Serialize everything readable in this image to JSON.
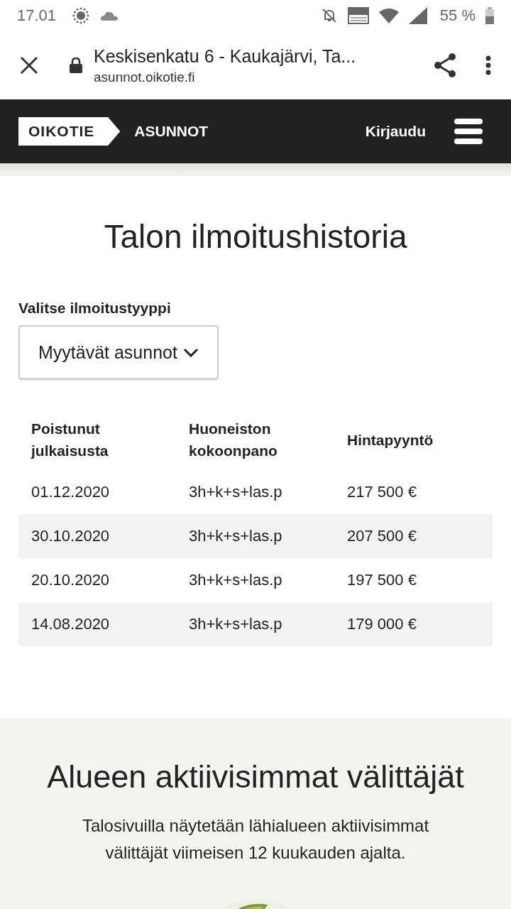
{
  "status_bar": {
    "time": "17.01",
    "battery": "55 %"
  },
  "browser": {
    "title": "Keskisenkatu 6 - Kaukajärvi, Ta...",
    "url": "asunnot.oikotie.fi"
  },
  "nav": {
    "logo": "OIKOTIE",
    "section": "ASUNNOT",
    "login": "Kirjaudu"
  },
  "history": {
    "title": "Talon ilmoitushistoria",
    "select_label": "Valitse ilmoitustyyppi",
    "select_value": "Myytävät asunnot",
    "columns": [
      "Poistunut julkaisusta",
      "Huoneiston kokoonpano",
      "Hintapyyntö"
    ],
    "rows": [
      [
        "01.12.2020",
        "3h+k+s+las.p",
        "217 500 €"
      ],
      [
        "30.10.2020",
        "3h+k+s+las.p",
        "207 500 €"
      ],
      [
        "20.10.2020",
        "3h+k+s+las.p",
        "197 500 €"
      ],
      [
        "14.08.2020",
        "3h+k+s+las.p",
        "179 000 €"
      ]
    ]
  },
  "agents": {
    "title": "Alueen aktiivisimmat välittäjät",
    "text": "Talosivuilla näytetään lähialueen aktiivisimmat välittäjät viimeisen 12 kuukauden ajalta."
  }
}
